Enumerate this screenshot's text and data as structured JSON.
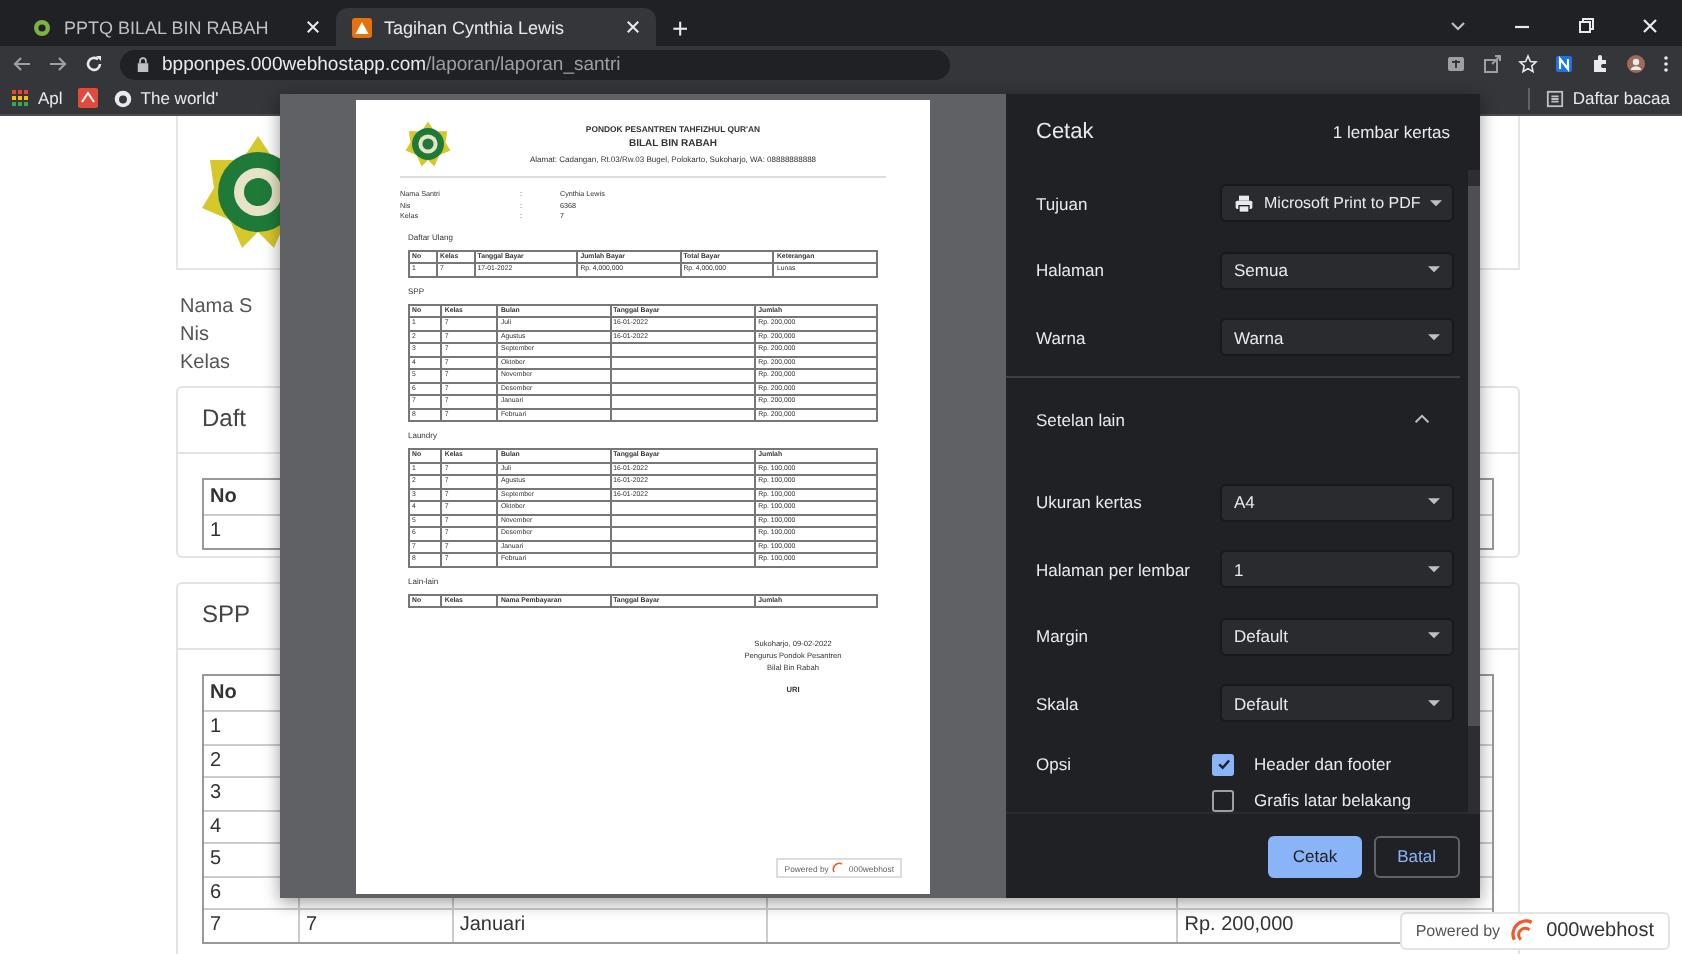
{
  "browser": {
    "tabs": [
      {
        "title": "PPTQ BILAL BIN RABAH",
        "selected": false
      },
      {
        "title": "Tagihan Cynthia Lewis",
        "selected": true
      }
    ],
    "new_tab": "+",
    "url": {
      "host": "bpponpes.000webhostapp.com",
      "path": "/laporan/laporan_santri"
    },
    "bookmarks": [
      "Apl",
      "The world'"
    ],
    "reading_list": "Daftar bacaa"
  },
  "page": {
    "info_labels": [
      "Nama S",
      "Nis",
      "Kelas"
    ],
    "cards": [
      {
        "title": "Daft",
        "columns": [
          "No"
        ],
        "rows": [
          {
            "no": "1"
          }
        ]
      },
      {
        "title": "SPP",
        "columns": [
          "No"
        ],
        "rows": [
          {
            "no": "1"
          },
          {
            "no": "2"
          },
          {
            "no": "3"
          },
          {
            "no": "4"
          },
          {
            "no": "5"
          },
          {
            "no": "6"
          },
          {
            "no": "7",
            "kelas": "7",
            "bulan": "Januari",
            "jumlah": "Rp. 200,000"
          }
        ]
      }
    ],
    "powered": {
      "prefix": "Powered by",
      "brand": "000webhost"
    }
  },
  "print_preview": {
    "document": {
      "org": "PONDOK PESANTREN TAHFIZHUL QUR'AN",
      "name": "BILAL BIN RABAH",
      "address": "Alamat: Cadangan, Rt.03/Rw.03 Bugel, Polokarto, Sukoharjo, WA: 08888888888",
      "info": [
        {
          "label": "Nama Santri",
          "sep": ":",
          "value": "Cynthia Lewis"
        },
        {
          "label": "Nis",
          "sep": ":",
          "value": "6368"
        },
        {
          "label": "Kelas",
          "sep": ":",
          "value": "7"
        }
      ],
      "sections": [
        {
          "title": "Daftar Ulang",
          "columns": [
            "No",
            "Kelas",
            "Tanggal Bayar",
            "Jumlah Bayar",
            "Total Bayar",
            "Keterangan"
          ],
          "rows": [
            [
              "1",
              "7",
              "17-01-2022",
              "Rp. 4,000,000",
              "Rp. 4,000,000",
              "Lunas"
            ]
          ]
        },
        {
          "title": "SPP",
          "columns": [
            "No",
            "Kelas",
            "Bulan",
            "Tanggal Bayar",
            "Jumlah"
          ],
          "rows": [
            [
              "1",
              "7",
              "Juli",
              "16-01-2022",
              "Rp. 200,000"
            ],
            [
              "2",
              "7",
              "Agustus",
              "16-01-2022",
              "Rp. 200,000"
            ],
            [
              "3",
              "7",
              "September",
              null,
              "Rp. 200,000"
            ],
            [
              "4",
              "7",
              "Oktober",
              null,
              "Rp. 200,000"
            ],
            [
              "5",
              "7",
              "November",
              null,
              "Rp. 200,000"
            ],
            [
              "6",
              "7",
              "Desember",
              null,
              "Rp. 200,000"
            ],
            [
              "7",
              "7",
              "Januari",
              null,
              "Rp. 200,000"
            ],
            [
              "8",
              "7",
              "Februari",
              null,
              "Rp. 200,000"
            ]
          ]
        },
        {
          "title": "Laundry",
          "columns": [
            "No",
            "Kelas",
            "Bulan",
            "Tanggal Bayar",
            "Jumlah"
          ],
          "rows": [
            [
              "1",
              "7",
              "Juli",
              "16-01-2022",
              "Rp. 100,000"
            ],
            [
              "2",
              "7",
              "Agustus",
              "16-01-2022",
              "Rp. 100,000"
            ],
            [
              "3",
              "7",
              "September",
              "16-01-2022",
              "Rp. 100,000"
            ],
            [
              "4",
              "7",
              "Oktober",
              null,
              "Rp. 100,000"
            ],
            [
              "5",
              "7",
              "November",
              null,
              "Rp. 100,000"
            ],
            [
              "6",
              "7",
              "Desember",
              null,
              "Rp. 100,000"
            ],
            [
              "7",
              "7",
              "Januari",
              null,
              "Rp. 100,000"
            ],
            [
              "8",
              "7",
              "Februari",
              null,
              "Rp. 100,000"
            ]
          ]
        },
        {
          "title": "Lain-lain",
          "columns": [
            "No",
            "Kelas",
            "Nama Pembayaran",
            "Tanggal Bayar",
            "Jumlah"
          ]
        }
      ],
      "signature": [
        "Sukoharjo, 09-02-2022",
        "Pengurus Pondok Pesantren",
        "Bilal Bin Rabah"
      ],
      "signer": "URI",
      "powered": {
        "prefix": "Powered by",
        "brand": "000webhost"
      }
    }
  },
  "print_panel": {
    "title": "Cetak",
    "sheets": "1 lembar kertas",
    "settings": [
      {
        "kind": "destination",
        "label": "Tujuan",
        "value": "Microsoft Print to PDF"
      },
      {
        "kind": "select",
        "label": "Halaman",
        "value": "Semua"
      },
      {
        "kind": "select",
        "label": "Warna",
        "value": "Warna"
      },
      {
        "kind": "section",
        "label": "Setelan lain",
        "expanded": true
      },
      {
        "kind": "select",
        "label": "Ukuran kertas",
        "value": "A4"
      },
      {
        "kind": "select",
        "label": "Halaman per lembar",
        "value": "1"
      },
      {
        "kind": "select",
        "label": "Margin",
        "value": "Default"
      },
      {
        "kind": "select",
        "label": "Skala",
        "value": "Default"
      },
      {
        "kind": "checkboxes",
        "label": "Opsi",
        "options": [
          {
            "label": "Header dan footer",
            "checked": true
          },
          {
            "label": "Grafis latar belakang",
            "checked": false
          }
        ]
      }
    ],
    "buttons": [
      {
        "label": "Cetak",
        "kind": "primary"
      },
      {
        "label": "Batal",
        "kind": "secondary"
      }
    ]
  }
}
